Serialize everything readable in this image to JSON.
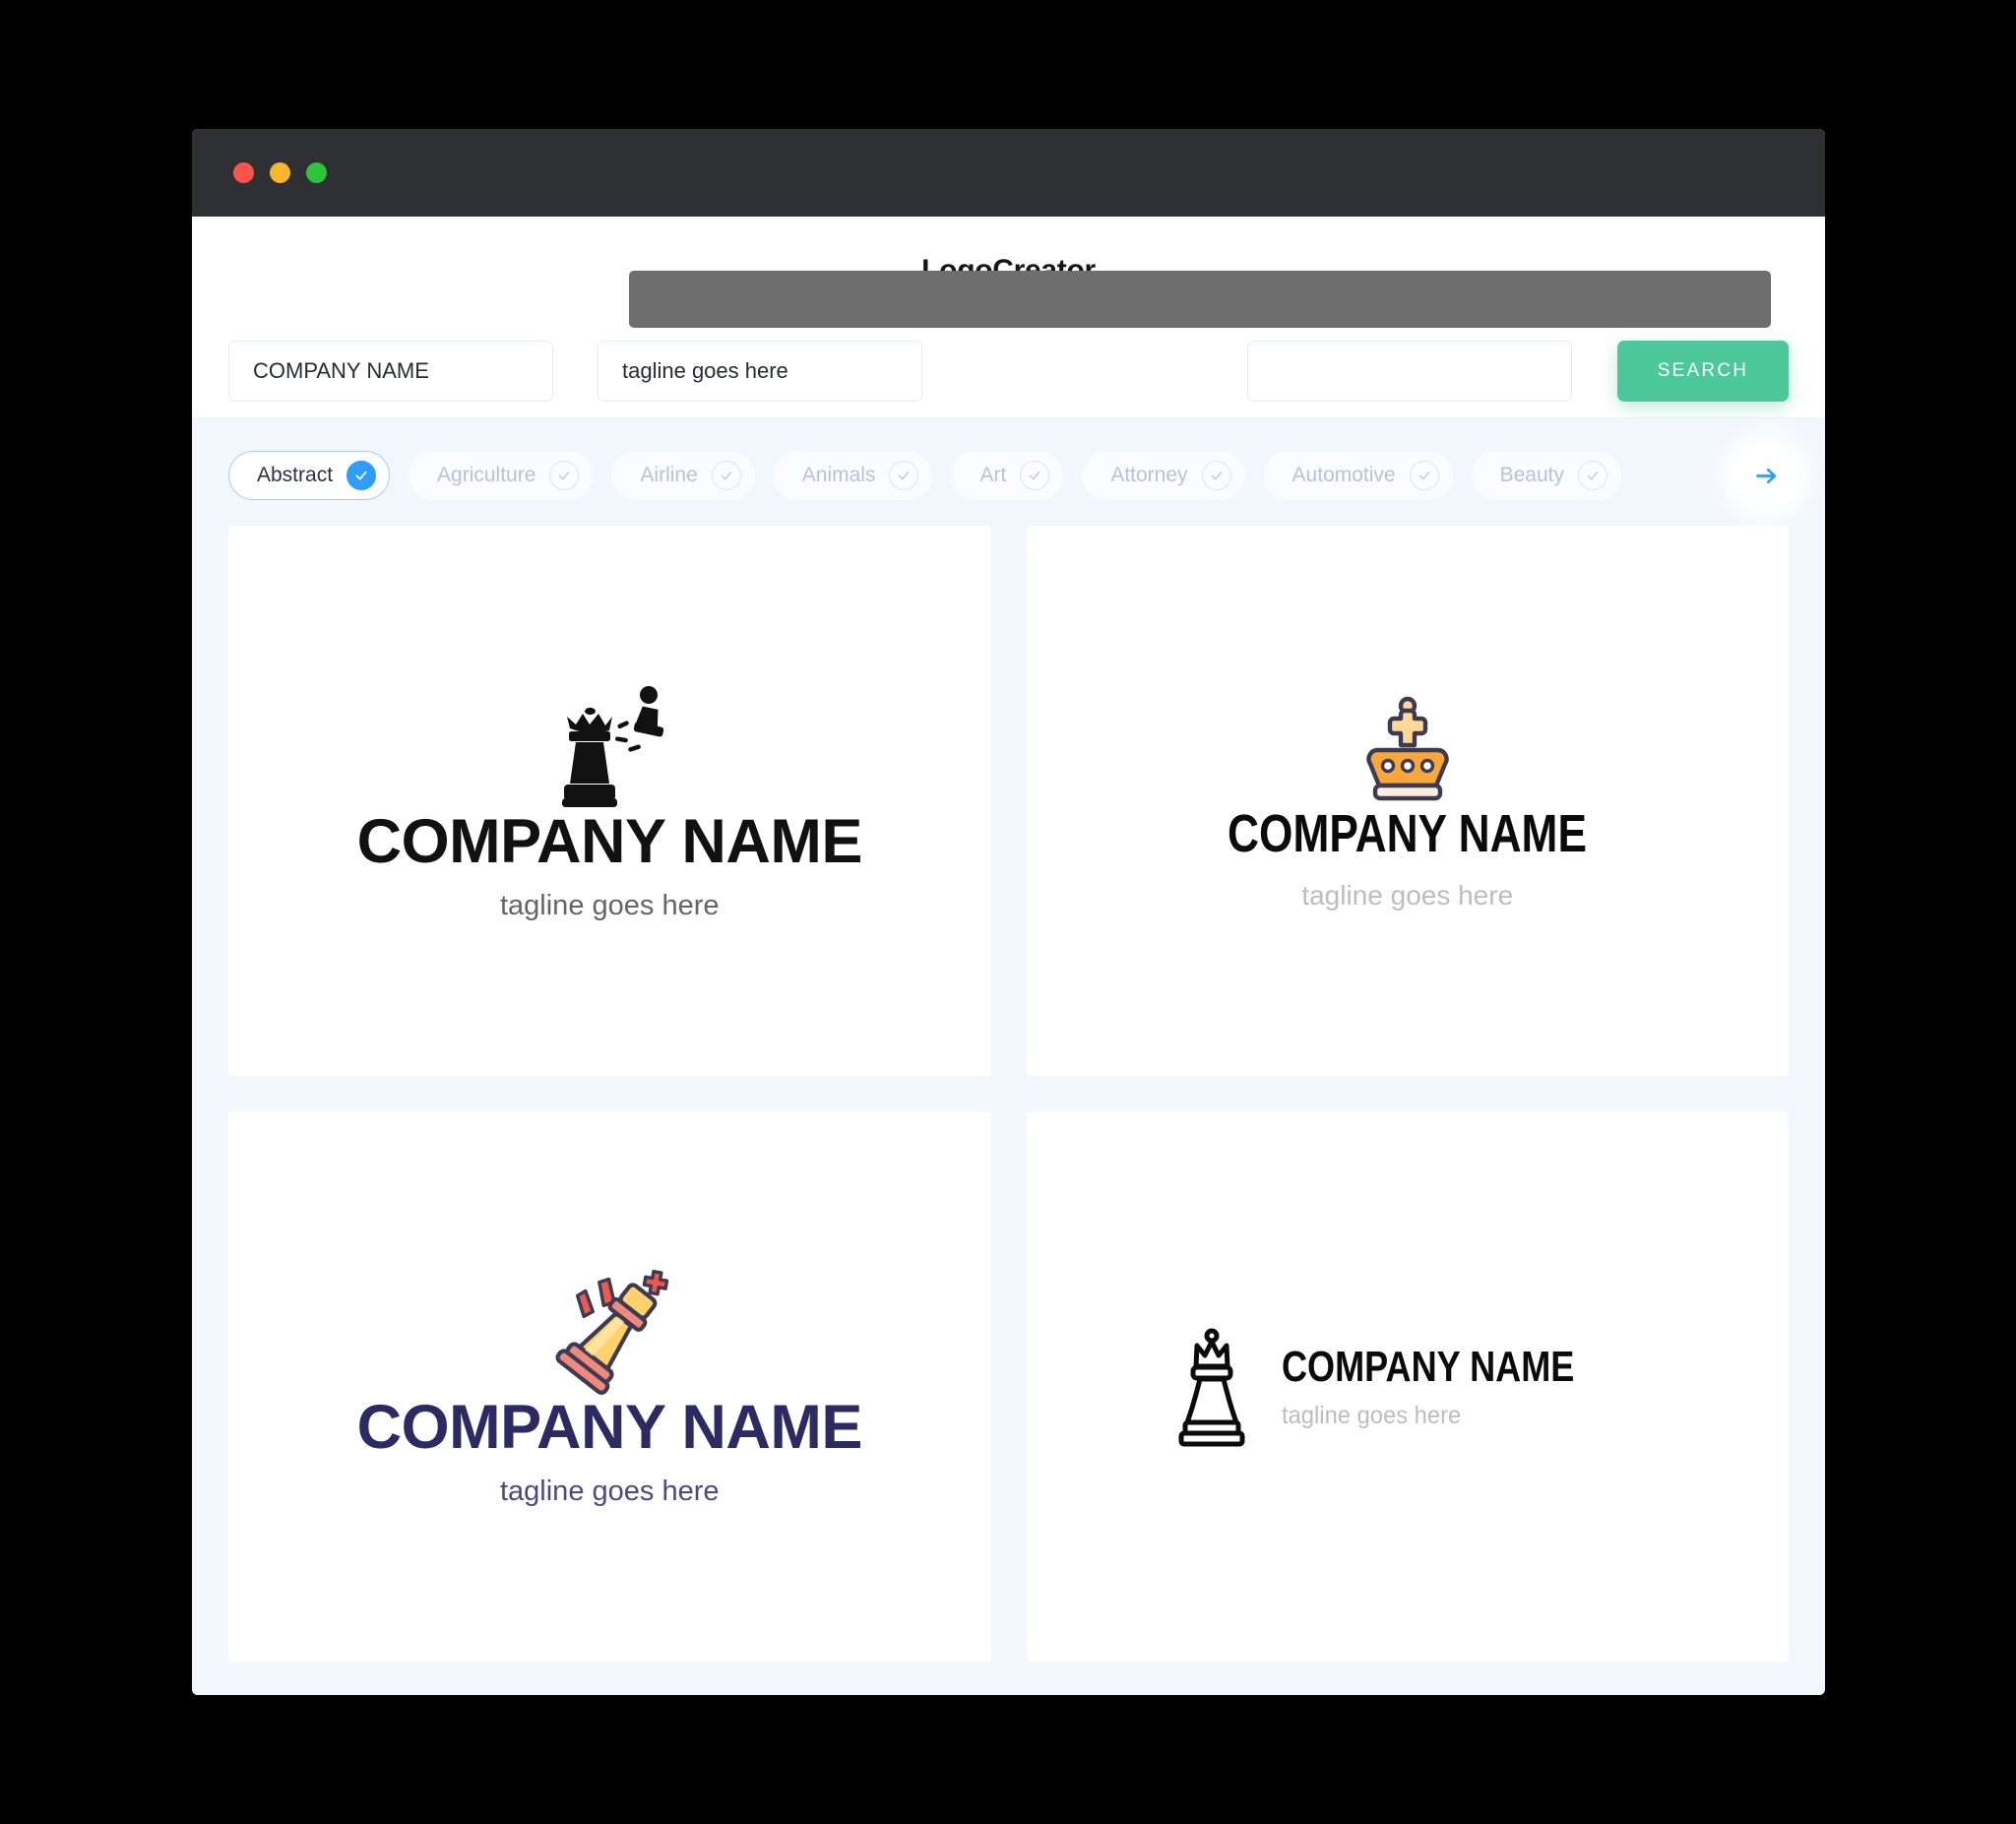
{
  "window": {
    "traffic_lights": [
      "close",
      "minimize",
      "maximize"
    ],
    "address_bar_value": ""
  },
  "header": {
    "title": "LogoCreator"
  },
  "search": {
    "company_value": "COMPANY NAME",
    "company_placeholder": "COMPANY NAME",
    "tagline_value": "tagline goes here",
    "tagline_placeholder": "tagline goes here",
    "extra_value": "",
    "extra_placeholder": "",
    "button_label": "SEARCH",
    "button_color": "#4ec79b"
  },
  "categories": {
    "active_color": "#2e9cf9",
    "next_label": "next",
    "items": [
      {
        "label": "Abstract",
        "selected": true
      },
      {
        "label": "Agriculture",
        "selected": false
      },
      {
        "label": "Airline",
        "selected": false
      },
      {
        "label": "Animals",
        "selected": false
      },
      {
        "label": "Art",
        "selected": false
      },
      {
        "label": "Attorney",
        "selected": false
      },
      {
        "label": "Automotive",
        "selected": false
      },
      {
        "label": "Beauty",
        "selected": false
      }
    ]
  },
  "logos": [
    {
      "mark": "black-shattered-queen-icon",
      "company": "COMPANY NAME",
      "tagline": "tagline goes here",
      "company_color": "#111111",
      "tagline_color": "#656565",
      "layout": "stacked"
    },
    {
      "mark": "orange-crown-icon",
      "company": "COMPANY NAME",
      "tagline": "tagline goes here",
      "company_color": "#0b0b0b",
      "tagline_color": "#bdbdbd",
      "layout": "stacked"
    },
    {
      "mark": "tilted-yellow-king-icon",
      "company": "COMPANY NAME",
      "tagline": "tagline goes here",
      "company_color": "#2b2a62",
      "tagline_color": "#4a4a86",
      "layout": "stacked"
    },
    {
      "mark": "outline-queen-icon",
      "company": "COMPANY NAME",
      "tagline": "tagline goes here",
      "company_color": "#0b0b0b",
      "tagline_color": "#bdbdbd",
      "layout": "horizontal"
    }
  ]
}
